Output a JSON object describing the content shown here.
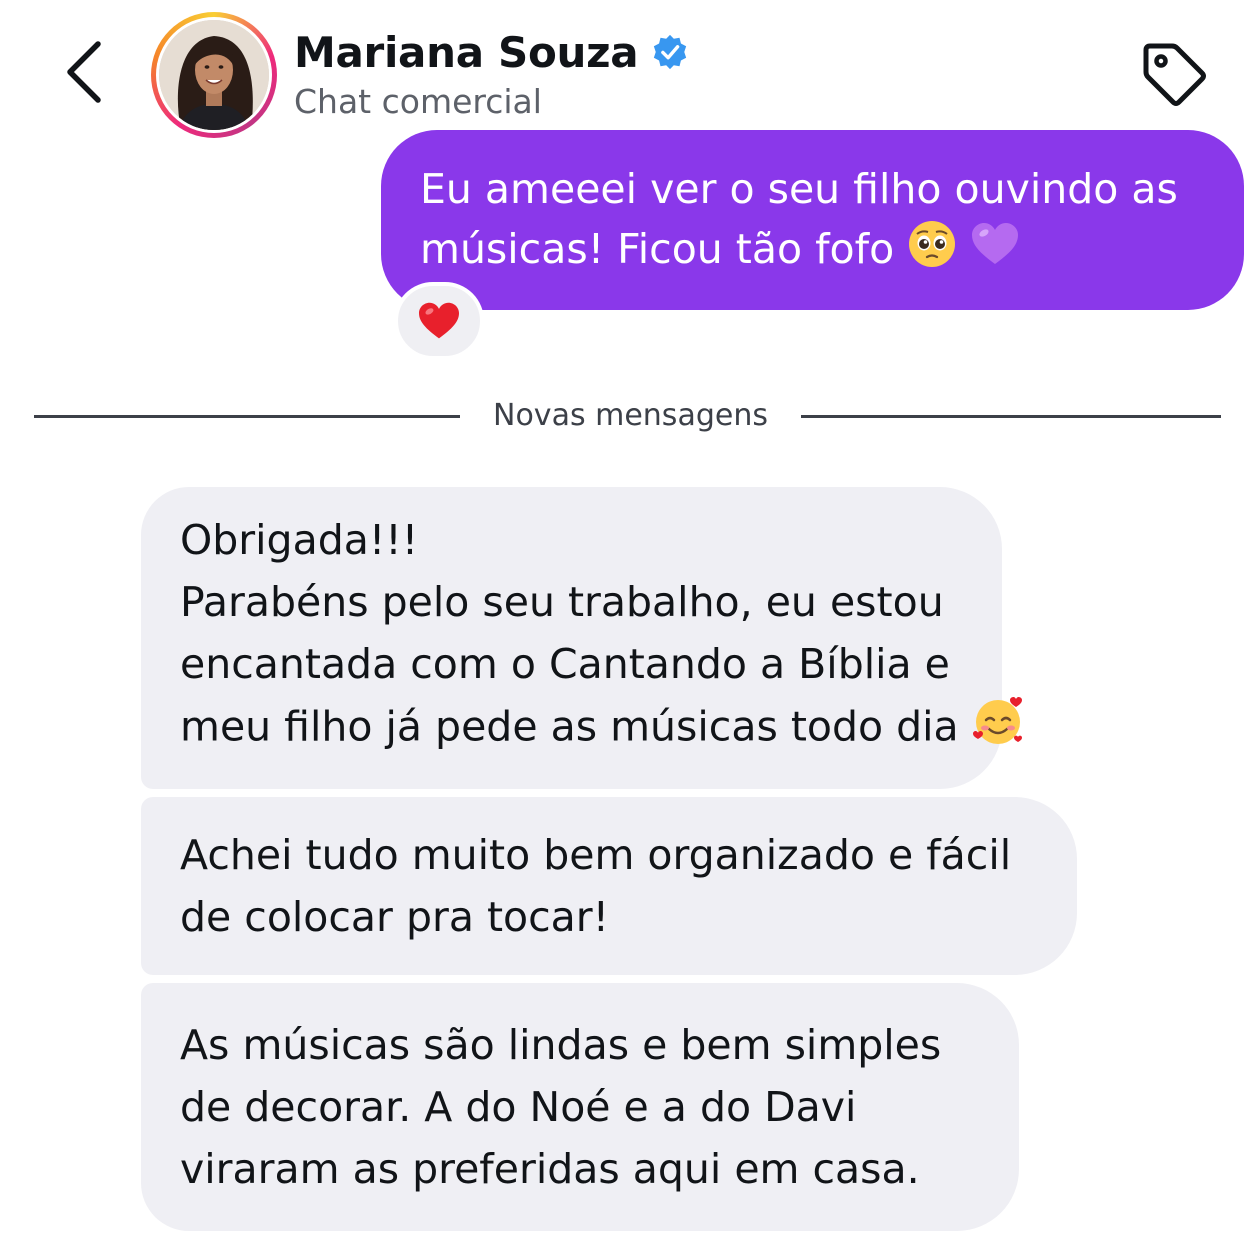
{
  "header": {
    "back_icon": "chevron-left-icon",
    "contact_name": "Mariana Souza",
    "verified_icon": "verified-badge-icon",
    "verified_color": "#3897f0",
    "subtitle": "Chat comercial",
    "tag_icon": "tag-icon"
  },
  "outgoing": {
    "lines": [
      "Eu ameeei ver o seu filho ouvindo as",
      "músicas! Ficou tão fofo"
    ],
    "emojis": [
      "pleading-face-emoji",
      "purple-heart-emoji"
    ],
    "bubble_color": "#8a38ea",
    "reaction_icon": "red-heart-icon"
  },
  "divider": {
    "label": "Novas mensagens"
  },
  "incoming": [
    {
      "lines": [
        "Obrigada!!!",
        "Parabéns pelo seu trabalho, eu estou",
        "encantada com o Cantando a Bíblia e",
        "meu filho já pede as músicas todo dia"
      ],
      "emoji": "smiling-face-with-hearts-emoji"
    },
    {
      "lines": [
        "Achei tudo muito bem organizado e fácil",
        "de colocar pra tocar!"
      ]
    },
    {
      "lines": [
        "As músicas são lindas e bem simples",
        "de decorar. A do Noé e a do Davi",
        "viraram as preferidas aqui em casa."
      ]
    }
  ]
}
